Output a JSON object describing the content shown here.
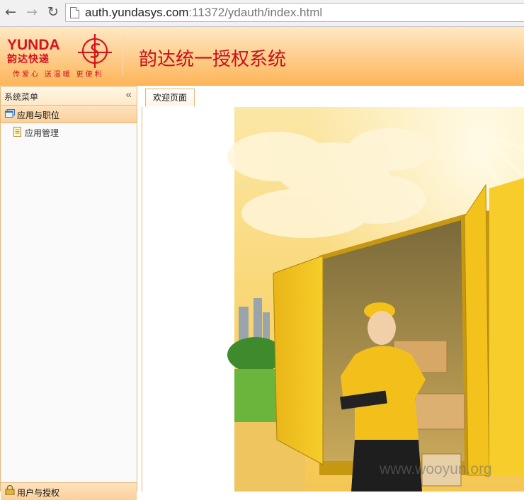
{
  "browser": {
    "back_icon": "←",
    "forward_icon": "→",
    "reload_icon": "↻",
    "url_host": "auth.yundasys.com",
    "url_rest": ":11372/ydauth/index.html"
  },
  "header": {
    "logo_en": "YUNDA",
    "logo_cn": "韵达快递",
    "logo_slogan": "传爱心 送温暖 更便利",
    "system_title": "韵达统一授权系统",
    "colors": {
      "brand_red": "#d3141e",
      "accent_orange": "#fdb55a"
    }
  },
  "sidebar": {
    "title": "系统菜单",
    "collapse_icon": "«",
    "groups": [
      {
        "label": "应用与职位",
        "icon": "window-icon",
        "items": [
          {
            "label": "应用管理",
            "icon": "document-icon"
          }
        ]
      },
      {
        "label": "用户与授权",
        "icon": "lock-icon"
      }
    ]
  },
  "tabs": [
    {
      "label": "欢迎页面"
    }
  ],
  "watermark": "www.wooyun.org"
}
